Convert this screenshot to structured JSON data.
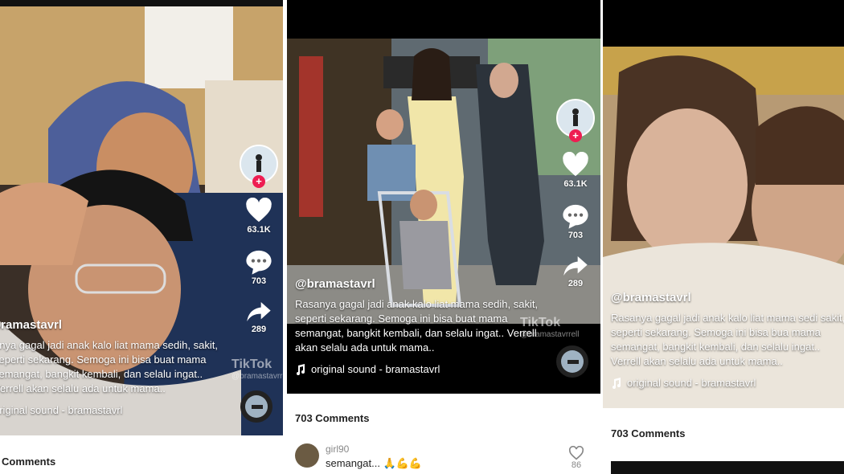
{
  "post": {
    "handle": "@bramastavrl",
    "handle_cut": "bramastavrl",
    "caption_full": "Rasanya gagal jadi anak kalo liat mama sedih, sakit, seperti sekarang. Semoga ini bisa buat mama semangat, bangkit kembali, dan selalu ingat.. Verrell akan selalu ada untuk mama..",
    "caption_p1": "anya gagal jadi anak kalo liat mama sedih, sakit, seperti sekarang. Semoga ini bisa buat mama semangat, bangkit kembali, dan selalu ingat.. Verrell akan selalu ada untuk mama..",
    "caption_p3": "Rasanya gagal jadi anak kalo liat mama sedi sakit, seperti sekarang. Semoga ini bisa bua mama semangat, bangkit kembali, dan selalu ingat.. Verrell akan selalu ada untuk mama..",
    "sound": "original sound - bramastavrl",
    "likes": "63.1K",
    "comments_count": "703",
    "shares": "289"
  },
  "watermark": {
    "brand": "TikTok",
    "user": "@bramastavrrell"
  },
  "comments": {
    "title": "703 Comments",
    "title_cut": "Comments",
    "items": [
      {
        "user": "girl90",
        "text": "semangat... 🙏💪💪",
        "likes": "86"
      }
    ]
  },
  "colors": {
    "accent": "#ee1d52",
    "text_dark": "#222222",
    "muted": "#888888"
  }
}
